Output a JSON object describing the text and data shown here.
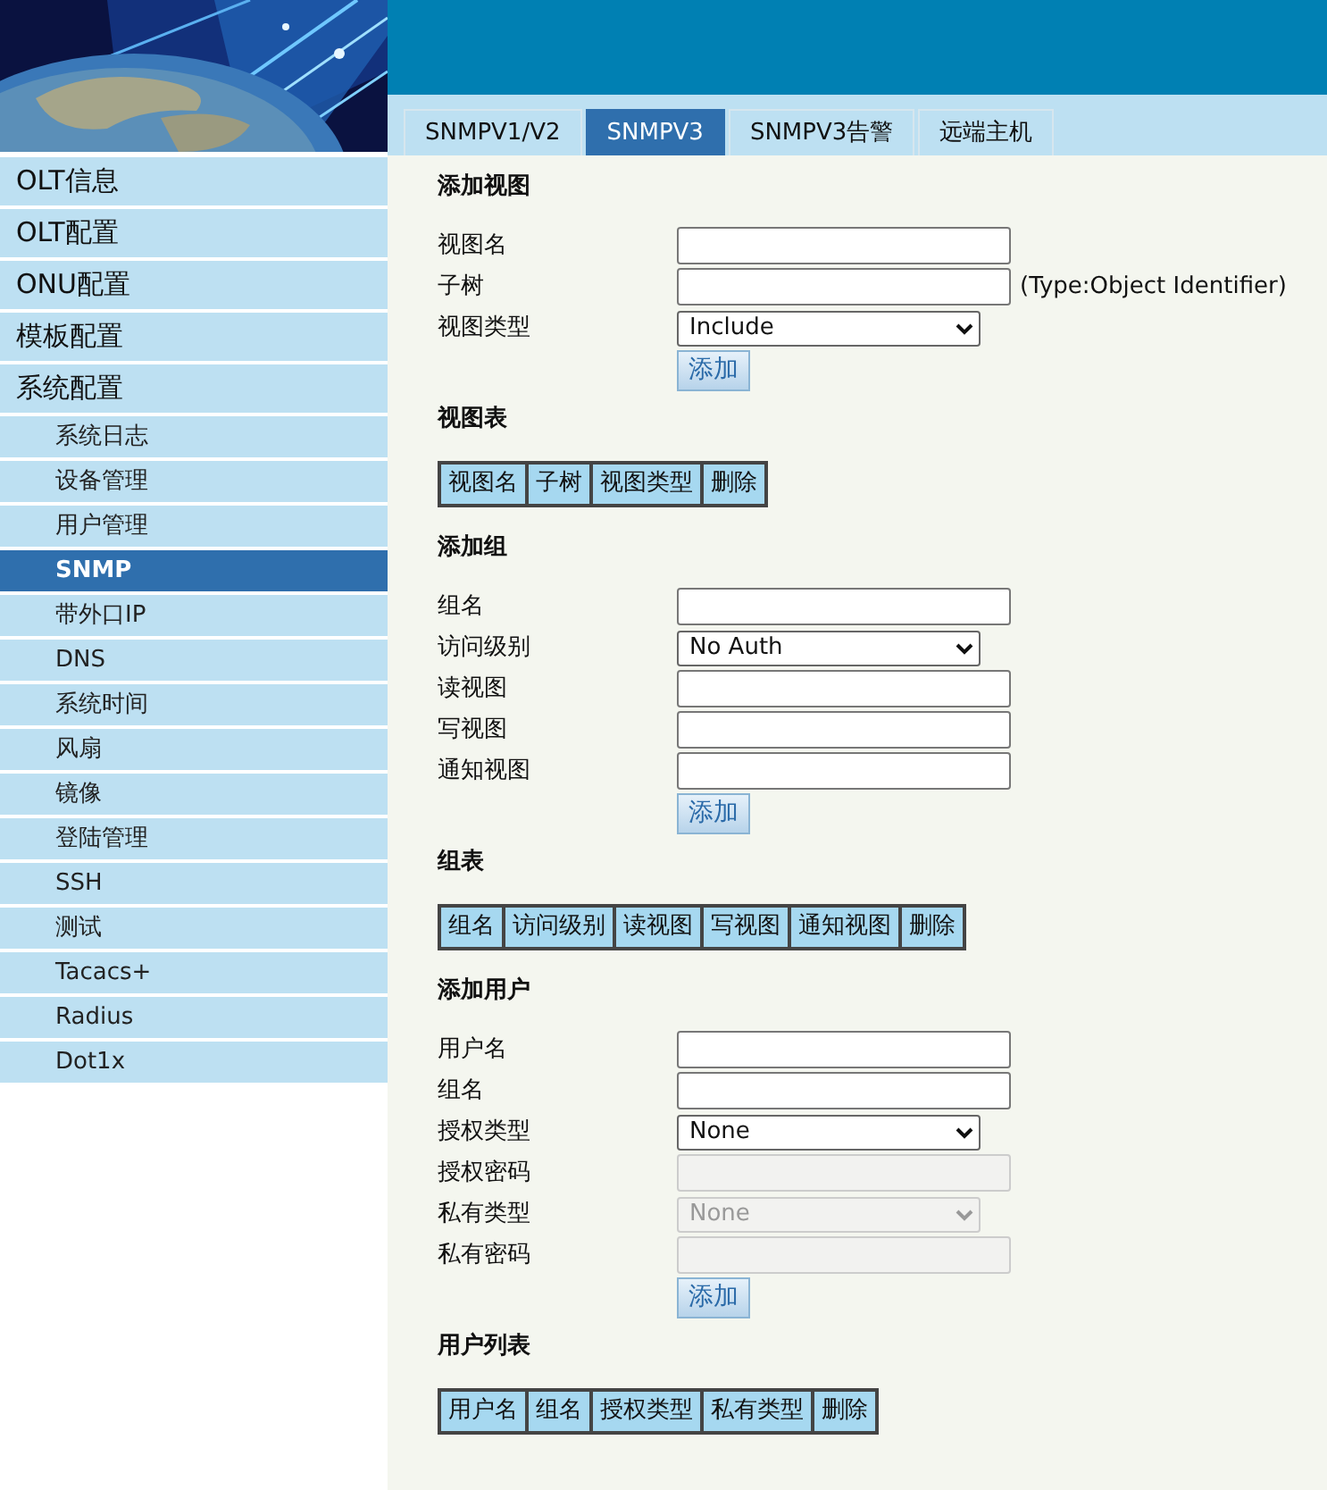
{
  "sidebar": {
    "items": [
      {
        "label": "OLT信息",
        "selected": false
      },
      {
        "label": "OLT配置",
        "selected": false
      },
      {
        "label": "ONU配置",
        "selected": false
      },
      {
        "label": "模板配置",
        "selected": false
      },
      {
        "label": "系统配置",
        "selected": false,
        "children": [
          {
            "label": "系统日志",
            "selected": false
          },
          {
            "label": "设备管理",
            "selected": false
          },
          {
            "label": "用户管理",
            "selected": false
          },
          {
            "label": "SNMP",
            "selected": true
          },
          {
            "label": "带外口IP",
            "selected": false
          },
          {
            "label": "DNS",
            "selected": false
          },
          {
            "label": "系统时间",
            "selected": false
          },
          {
            "label": "风扇",
            "selected": false
          },
          {
            "label": "镜像",
            "selected": false
          },
          {
            "label": "登陆管理",
            "selected": false
          },
          {
            "label": "SSH",
            "selected": false
          },
          {
            "label": "测试",
            "selected": false
          },
          {
            "label": "Tacacs+",
            "selected": false
          },
          {
            "label": "Radius",
            "selected": false
          },
          {
            "label": "Dot1x",
            "selected": false
          }
        ]
      }
    ]
  },
  "tabs": [
    {
      "label": "SNMPV1/V2",
      "selected": false
    },
    {
      "label": "SNMPV3",
      "selected": true
    },
    {
      "label": "SNMPV3告警",
      "selected": false
    },
    {
      "label": "远端主机",
      "selected": false
    }
  ],
  "sections": [
    {
      "heading": "添加视图",
      "fields": [
        {
          "label": "视图名",
          "kind": "text",
          "disabled": false
        },
        {
          "label": "子树",
          "kind": "text",
          "disabled": false,
          "note": "(Type:Object Identifier)"
        },
        {
          "label": "视图类型",
          "kind": "select",
          "value": "Include",
          "disabled": false
        }
      ],
      "button": "添加",
      "table_heading": "视图表",
      "columns": [
        "视图名",
        "子树",
        "视图类型",
        "删除"
      ]
    },
    {
      "heading": "添加组",
      "fields": [
        {
          "label": "组名",
          "kind": "text",
          "disabled": false
        },
        {
          "label": "访问级别",
          "kind": "select",
          "value": "No Auth",
          "disabled": false
        },
        {
          "label": "读视图",
          "kind": "text",
          "disabled": false
        },
        {
          "label": "写视图",
          "kind": "text",
          "disabled": false
        },
        {
          "label": "通知视图",
          "kind": "text",
          "disabled": false
        }
      ],
      "button": "添加",
      "table_heading": "组表",
      "columns": [
        "组名",
        "访问级别",
        "读视图",
        "写视图",
        "通知视图",
        "删除"
      ]
    },
    {
      "heading": "添加用户",
      "fields": [
        {
          "label": "用户名",
          "kind": "text",
          "disabled": false
        },
        {
          "label": "组名",
          "kind": "text",
          "disabled": false
        },
        {
          "label": "授权类型",
          "kind": "select",
          "value": "None",
          "disabled": false
        },
        {
          "label": "授权密码",
          "kind": "text",
          "disabled": true
        },
        {
          "label": "私有类型",
          "kind": "select",
          "value": "None",
          "disabled": true
        },
        {
          "label": "私有密码",
          "kind": "text",
          "disabled": true
        }
      ],
      "button": "添加",
      "table_heading": "用户列表",
      "columns": [
        "用户名",
        "组名",
        "授权类型",
        "私有类型",
        "删除"
      ]
    }
  ]
}
